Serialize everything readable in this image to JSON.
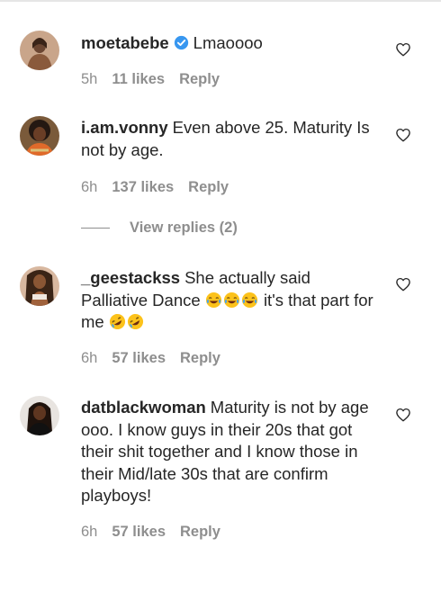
{
  "icons": {
    "like": "heart-outline-icon",
    "verified": "verified-badge-icon"
  },
  "colors": {
    "text": "#262626",
    "muted": "#8e8e8e",
    "verified": "#3897f0"
  },
  "comments": [
    {
      "username": "moetabebe",
      "verified": true,
      "text": "Lmaoooo",
      "time": "5h",
      "likes": "11 likes",
      "reply": "Reply"
    },
    {
      "username": "i.am.vonny",
      "verified": false,
      "text": "Even above 25. Maturity Is not by age.",
      "time": "6h",
      "likes": "137 likes",
      "reply": "Reply",
      "view_replies": "View replies (2)"
    },
    {
      "username": "_geestackss",
      "verified": false,
      "text": "She actually said Palliative Dance",
      "text_after_emoji": "it's that part for me",
      "emoji_names": [
        "tears-of-joy-emoji",
        "tears-of-joy-emoji",
        "tears-of-joy-emoji",
        "rofl-emoji",
        "rofl-emoji"
      ],
      "time": "6h",
      "likes": "57 likes",
      "reply": "Reply"
    },
    {
      "username": "datblackwoman",
      "verified": false,
      "text": "Maturity is not by age ooo. I know guys in their 20s that got their shit together and I know those in their Mid/late 30s that are confirm playboys!",
      "time": "6h",
      "likes": "57 likes",
      "reply": "Reply"
    }
  ]
}
